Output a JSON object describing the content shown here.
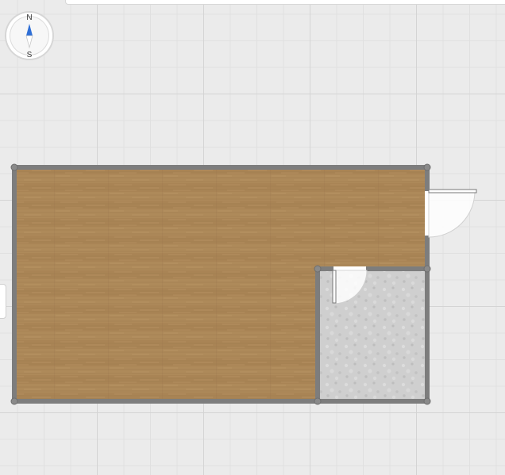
{
  "compass": {
    "north_label": "N",
    "south_label": "S",
    "needle_color": "#2f6fd6"
  },
  "floorplan": {
    "rooms": [
      {
        "name": "main-room",
        "floor": "wood"
      },
      {
        "name": "small-room",
        "floor": "stone"
      }
    ],
    "doors": [
      "entry-door",
      "small-room-door"
    ],
    "colors": {
      "wall": "#7d7d7d",
      "wood": "#a98455",
      "stone": "#cfcfcf",
      "grid_major": "#d4d4d4",
      "grid_minor": "#e0e0e0"
    }
  }
}
